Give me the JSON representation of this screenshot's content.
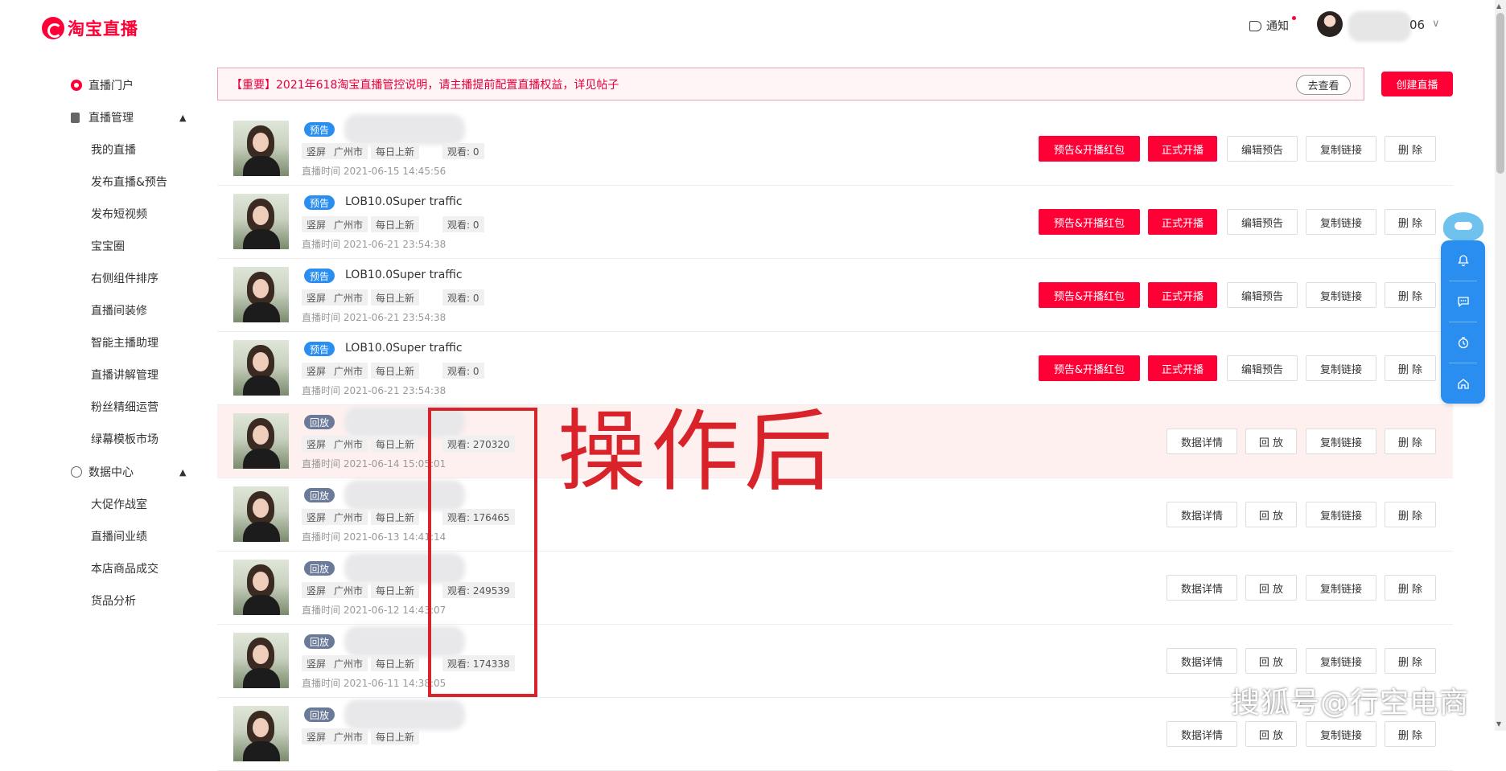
{
  "header": {
    "logo_text": "淘宝直播",
    "notify_label": "通知",
    "username_suffix": "06",
    "caret": "∨"
  },
  "sidebar": {
    "items": [
      {
        "label": "直播门户",
        "level": "group",
        "icon": "portal-icon"
      },
      {
        "label": "直播管理",
        "level": "group",
        "icon": "document-icon",
        "expanded": true
      },
      {
        "label": "我的直播",
        "level": "sub"
      },
      {
        "label": "发布直播&预告",
        "level": "sub"
      },
      {
        "label": "发布短视频",
        "level": "sub"
      },
      {
        "label": "宝宝圈",
        "level": "sub"
      },
      {
        "label": "右侧组件排序",
        "level": "sub"
      },
      {
        "label": "直播间装修",
        "level": "sub"
      },
      {
        "label": "智能主播助理",
        "level": "sub"
      },
      {
        "label": "直播讲解管理",
        "level": "sub"
      },
      {
        "label": "粉丝精细运营",
        "level": "sub"
      },
      {
        "label": "绿幕模板市场",
        "level": "sub"
      },
      {
        "label": "数据中心",
        "level": "group",
        "icon": "clock-icon",
        "expanded": true
      },
      {
        "label": "大促作战室",
        "level": "sub"
      },
      {
        "label": "直播间业绩",
        "level": "sub"
      },
      {
        "label": "本店商品成交",
        "level": "sub"
      },
      {
        "label": "货品分析",
        "level": "sub"
      }
    ],
    "expand_arrow": "▲"
  },
  "notice": {
    "text": "【重要】2021年618淘宝直播管控说明，请主播提前配置直播权益，详见帖子",
    "button": "去查看"
  },
  "create_button": "创建直播",
  "tags": {
    "orientation": "竖屏",
    "city": "广州市",
    "update": "每日上新"
  },
  "buttons": {
    "preview_redpacket": "预告&开播红包",
    "start_live": "正式开播",
    "edit_preview": "编辑预告",
    "copy_link": "复制链接",
    "delete": "删 除",
    "data_detail": "数据详情",
    "replay": "回 放"
  },
  "live_list": [
    {
      "status": "预告",
      "type": "preview",
      "title": "",
      "views": "观看: 0",
      "time": "直播时间 2021-06-15 14:45:56"
    },
    {
      "status": "预告",
      "type": "preview",
      "title": "LOB10.0Super traffic",
      "views": "观看: 0",
      "time": "直播时间 2021-06-21 23:54:38"
    },
    {
      "status": "预告",
      "type": "preview",
      "title": "LOB10.0Super traffic",
      "views": "观看: 0",
      "time": "直播时间 2021-06-21 23:54:38"
    },
    {
      "status": "预告",
      "type": "preview",
      "title": "LOB10.0Super traffic",
      "views": "观看: 0",
      "time": "直播时间 2021-06-21 23:54:38"
    },
    {
      "status": "回放",
      "type": "replay",
      "title": "",
      "views": "观看: 270320",
      "time": "直播时间 2021-06-14 15:05:01"
    },
    {
      "status": "回放",
      "type": "replay",
      "title": "",
      "views": "观看: 176465",
      "time": "直播时间 2021-06-13 14:41:14"
    },
    {
      "status": "回放",
      "type": "replay",
      "title": "",
      "views": "观看: 249539",
      "time": "直播时间 2021-06-12 14:43:07"
    },
    {
      "status": "回放",
      "type": "replay",
      "title": "",
      "views": "观看: 174338",
      "time": "直播时间 2021-06-11 14:38:05"
    },
    {
      "status": "回放",
      "type": "replay",
      "title": "",
      "views": "",
      "time": ""
    }
  ],
  "floating_toolbar": {
    "items": [
      "bell-icon",
      "message-icon",
      "clock-icon",
      "home-icon"
    ]
  },
  "annotation": {
    "text": "操作后",
    "color": "#d8232a"
  },
  "watermark": "搜狐号@行空电商",
  "colors": {
    "brand_red": "#ff0036",
    "preview_blue": "#2a8ef0",
    "replay_gray": "#6a7a98"
  }
}
